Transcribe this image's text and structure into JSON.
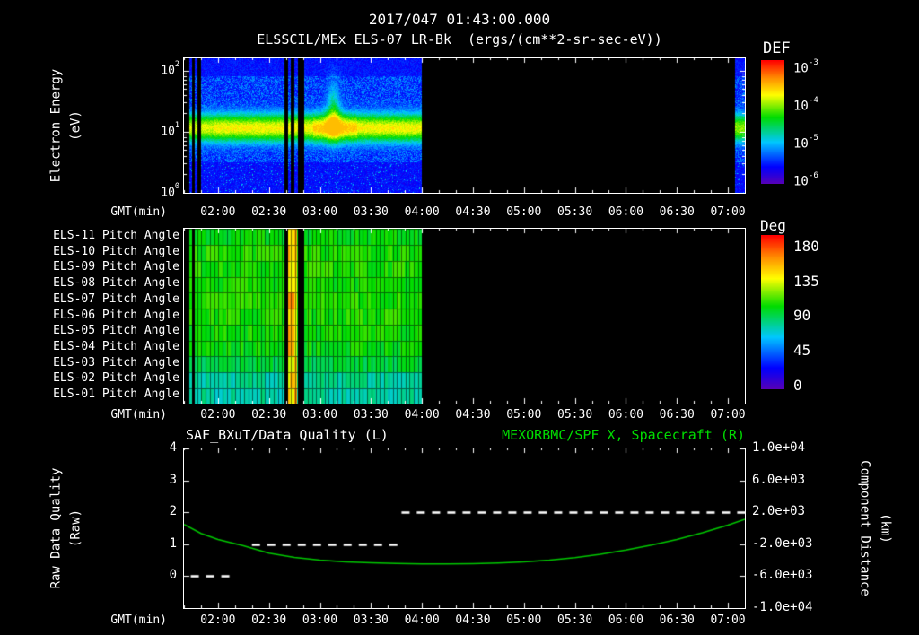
{
  "header": {
    "timestamp": "2017/047 01:43:00.000",
    "title": "ELSSCIL/MEx ELS-07 LR-Bk",
    "units": "(ergs/(cm**2-sr-sec-eV))"
  },
  "time_axis": {
    "label": "GMT(min)",
    "start_min": 100,
    "end_min": 430,
    "major_ticks_min": [
      120,
      150,
      180,
      210,
      240,
      270,
      300,
      330,
      360,
      390,
      420
    ],
    "tick_labels": [
      "02:00",
      "02:30",
      "03:00",
      "03:30",
      "04:00",
      "04:30",
      "05:00",
      "05:30",
      "06:00",
      "06:30",
      "07:00"
    ],
    "minor_step_min": 10
  },
  "colors": {
    "background": "#000000",
    "foreground": "#ffffff",
    "accent_green": "#00dd00",
    "colormap_stops": [
      [
        0,
        "#5a00b4"
      ],
      [
        0.14,
        "#0000ff"
      ],
      [
        0.34,
        "#00c8ff"
      ],
      [
        0.54,
        "#00dc00"
      ],
      [
        0.72,
        "#ffff00"
      ],
      [
        0.86,
        "#ff8c00"
      ],
      [
        1,
        "#ff0000"
      ]
    ]
  },
  "chart_data": [
    {
      "type": "heatmap",
      "name": "electron-energy-spectrogram",
      "ylabel_lines": [
        "Electron Energy",
        "(eV)"
      ],
      "y_scale": "log10_eV",
      "ylim_log": [
        0,
        2.2
      ],
      "y_tick_exponents": [
        0,
        1,
        2
      ],
      "value_units": "ergs/(cm**2-sr-sec-eV)",
      "value_log_range": [
        -6.5,
        -3.0
      ],
      "colorbar": {
        "title": "DEF",
        "tick_exponents": [
          -3,
          -4,
          -5,
          -6
        ]
      },
      "data_intervals_min": [
        [
          103,
          240
        ],
        [
          424,
          430
        ]
      ],
      "gap_intervals_min": [
        [
          104.5,
          106.5
        ],
        [
          108,
          110
        ],
        [
          159,
          161
        ],
        [
          163,
          165
        ],
        [
          167,
          171
        ]
      ],
      "band": {
        "center_log_eV": 1.06,
        "sigma_log": 0.17,
        "peak_log_flux": -4.1,
        "background_log_flux": -6.0
      },
      "plume": {
        "time_min": 188,
        "center_log_eV": 1.35,
        "extra_log_flux": 1.0
      }
    },
    {
      "type": "heatmap",
      "name": "pitch-angle-panels",
      "row_labels": [
        "ELS-11 Pitch Angle",
        "ELS-10 Pitch Angle",
        "ELS-09 Pitch Angle",
        "ELS-08 Pitch Angle",
        "ELS-07 Pitch Angle",
        "ELS-06 Pitch Angle",
        "ELS-05 Pitch Angle",
        "ELS-04 Pitch Angle",
        "ELS-03 Pitch Angle",
        "ELS-02 Pitch Angle",
        "ELS-01 Pitch Angle"
      ],
      "value_range_deg": [
        0,
        180
      ],
      "colorbar": {
        "title": "Deg",
        "ticks": [
          180,
          135,
          90,
          45,
          0
        ]
      },
      "data_intervals_min": [
        [
          103,
          240
        ]
      ],
      "gap_intervals_min": [
        [
          104.5,
          106.5
        ],
        [
          159,
          161
        ],
        [
          167,
          171
        ]
      ],
      "row_base_deg": [
        95,
        100,
        100,
        98,
        100,
        100,
        98,
        96,
        88,
        76,
        74
      ],
      "stripe": {
        "interval_min": [
          161.5,
          166.5
        ],
        "value_deg": 140
      },
      "grid_step_min": 2.5
    },
    {
      "type": "line",
      "name": "quality-and-distance",
      "title_left": "SAF_BXuT/Data Quality (L)",
      "title_right": "MEXORBMC/SPF X, Spacecraft (R)",
      "ylabel_left_lines": [
        "Raw Data Quality",
        "(Raw)"
      ],
      "ylabel_right_lines": [
        "Component Distance",
        "(km)"
      ],
      "ylim_left": [
        -1,
        4
      ],
      "yticks_left": [
        4,
        3,
        2,
        1,
        0
      ],
      "ylim_right": [
        -10000,
        10000
      ],
      "yticks_right_labels": [
        "1.0e+04",
        "6.0e+03",
        "2.0e+03",
        "-2.0e+03",
        "-6.0e+03",
        "-1.0e+04"
      ],
      "yticks_right_values": [
        10000,
        6000,
        2000,
        -2000,
        -6000,
        -10000
      ],
      "series": [
        {
          "name": "MEXORBMC/SPF X Spacecraft",
          "axis": "right",
          "color": "#00c800",
          "style": "solid",
          "points": [
            [
              100,
              480
            ],
            [
              110,
              -640
            ],
            [
              120,
              -1400
            ],
            [
              135,
              -2200
            ],
            [
              150,
              -3120
            ],
            [
              165,
              -3640
            ],
            [
              180,
              -4000
            ],
            [
              195,
              -4200
            ],
            [
              210,
              -4330
            ],
            [
              225,
              -4420
            ],
            [
              240,
              -4460
            ],
            [
              255,
              -4470
            ],
            [
              270,
              -4440
            ],
            [
              285,
              -4340
            ],
            [
              300,
              -4200
            ],
            [
              315,
              -3980
            ],
            [
              330,
              -3680
            ],
            [
              345,
              -3260
            ],
            [
              360,
              -2720
            ],
            [
              375,
              -2100
            ],
            [
              390,
              -1400
            ],
            [
              405,
              -560
            ],
            [
              420,
              400
            ],
            [
              430,
              1120
            ]
          ]
        },
        {
          "name": "SAF_BXuT Data Quality",
          "axis": "left",
          "color": "#ffffff",
          "style": "dashed",
          "segments": [
            {
              "value": 0,
              "from_min": 104,
              "to_min": 128
            },
            {
              "value": 1,
              "from_min": 140,
              "to_min": 227
            },
            {
              "value": 2,
              "from_min": 228,
              "to_min": 430
            }
          ]
        }
      ]
    }
  ]
}
